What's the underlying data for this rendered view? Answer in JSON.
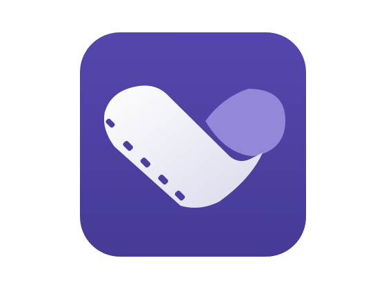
{
  "icon": {
    "name": "video-app-icon",
    "colors": {
      "background_top": "#5546ad",
      "background_bottom": "#453b96",
      "film": "#ffffff",
      "film_shadow": "#d9d9ec",
      "sprocket_holes": "#4a3f9f",
      "droplet": "#9287d9"
    }
  }
}
